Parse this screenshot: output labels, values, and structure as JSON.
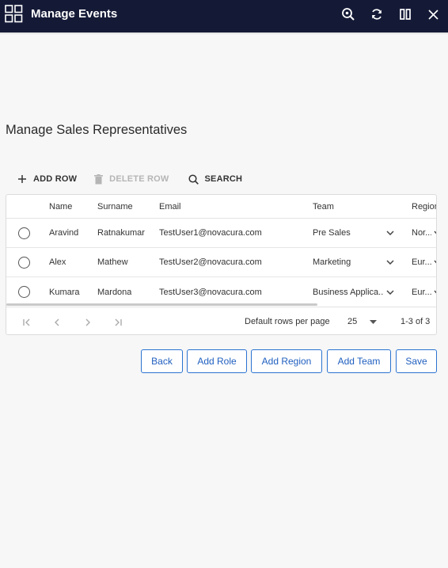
{
  "window": {
    "title": "Manage Events",
    "icons": [
      "grid-icon",
      "zoom-search-icon",
      "refresh-icon",
      "split-view-icon",
      "close-icon"
    ]
  },
  "page": {
    "title": "Manage Sales Representatives"
  },
  "toolbar": {
    "add_row": "ADD ROW",
    "delete_row": "DELETE ROW",
    "search": "SEARCH"
  },
  "table": {
    "columns": [
      "Name",
      "Surname",
      "Email",
      "Team",
      "Region"
    ],
    "rows": [
      {
        "name": "Aravind",
        "surname": "Ratnakumar",
        "email": "TestUser1@novacura.com",
        "team": "Pre Sales",
        "region": "Nor..."
      },
      {
        "name": "Alex",
        "surname": "Mathew",
        "email": "TestUser2@novacura.com",
        "team": "Marketing",
        "region": "Eur..."
      },
      {
        "name": "Kumara",
        "surname": "Mardona",
        "email": "TestUser3@novacura.com",
        "team": "Business Applica...",
        "region": "Eur..."
      }
    ]
  },
  "pagination": {
    "rows_per_page_label": "Default rows per page",
    "rows_per_page": "25",
    "range": "1-3 of 3"
  },
  "actions": {
    "back": "Back",
    "add_role": "Add Role",
    "add_region": "Add Region",
    "add_team": "Add Team",
    "save": "Save"
  },
  "colors": {
    "titlebar": "#141a36",
    "accent": "#2b73d1",
    "background": "#f7f7f7"
  }
}
